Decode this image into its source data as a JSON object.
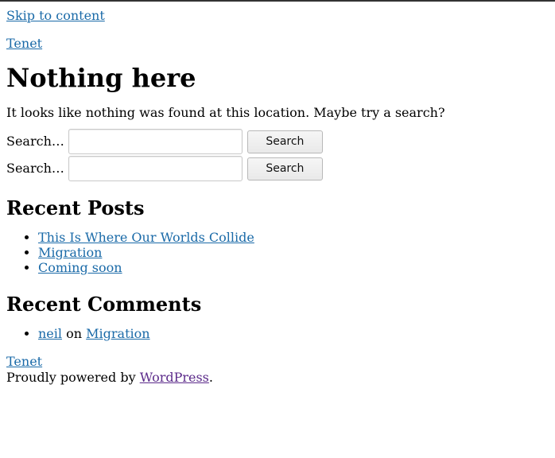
{
  "skip_link": "Skip to content",
  "site_title": "Tenet",
  "page_title": "Nothing here",
  "notice": "It looks like nothing was found at this location. Maybe try a search?",
  "search_forms": [
    {
      "label": "Search…",
      "value": "",
      "button": "Search"
    },
    {
      "label": "Search…",
      "value": "",
      "button": "Search"
    }
  ],
  "recent_posts": {
    "title": "Recent Posts",
    "items": [
      "This Is Where Our Worlds Collide",
      "Migration",
      "Coming soon"
    ]
  },
  "recent_comments": {
    "title": "Recent Comments",
    "items": [
      {
        "author": "neil",
        "connector": "on",
        "post": "Migration"
      }
    ]
  },
  "footer": {
    "site_title": "Tenet",
    "powered_prefix": "Proudly powered by",
    "powered_link": "WordPress",
    "powered_suffix": "."
  },
  "colors": {
    "link": "#1a6aa8",
    "visited_link": "#5b2a8a",
    "text": "#000000"
  }
}
